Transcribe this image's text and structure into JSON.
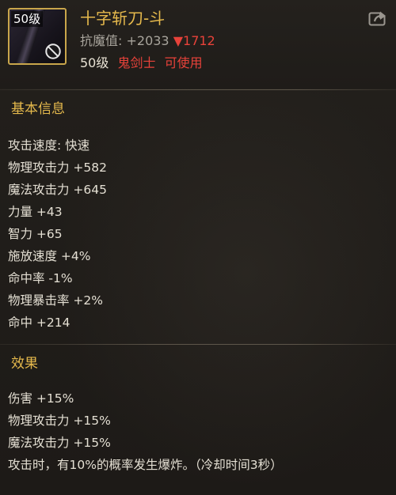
{
  "item": {
    "level_badge": "50级",
    "name": "十字斩刀-斗",
    "resist_label": "抗魔值: ",
    "resist_value": "+2033",
    "resist_down": "▼1712",
    "level": "50级",
    "class": "鬼剑士",
    "usable": "可使用"
  },
  "basic": {
    "title": "基本信息",
    "stats": [
      "攻击速度: 快速",
      "物理攻击力 +582",
      "魔法攻击力 +645",
      "力量 +43",
      "智力 +65",
      "施放速度 +4%",
      "命中率 -1%",
      "物理暴击率 +2%",
      "命中 +214"
    ]
  },
  "effects": {
    "title": "效果",
    "lines": [
      "伤害 +15%",
      "物理攻击力 +15%",
      "魔法攻击力 +15%",
      "攻击时，有10%的概率发生爆炸。（冷却时间3秒）"
    ]
  },
  "colors": {
    "accent_gold": "#e5b94c",
    "warning_red": "#e8423a",
    "text_main": "#e4dfd3",
    "text_dim": "#a8a49c"
  },
  "icons": {
    "forbidden": "forbidden-icon",
    "share": "share-icon"
  }
}
